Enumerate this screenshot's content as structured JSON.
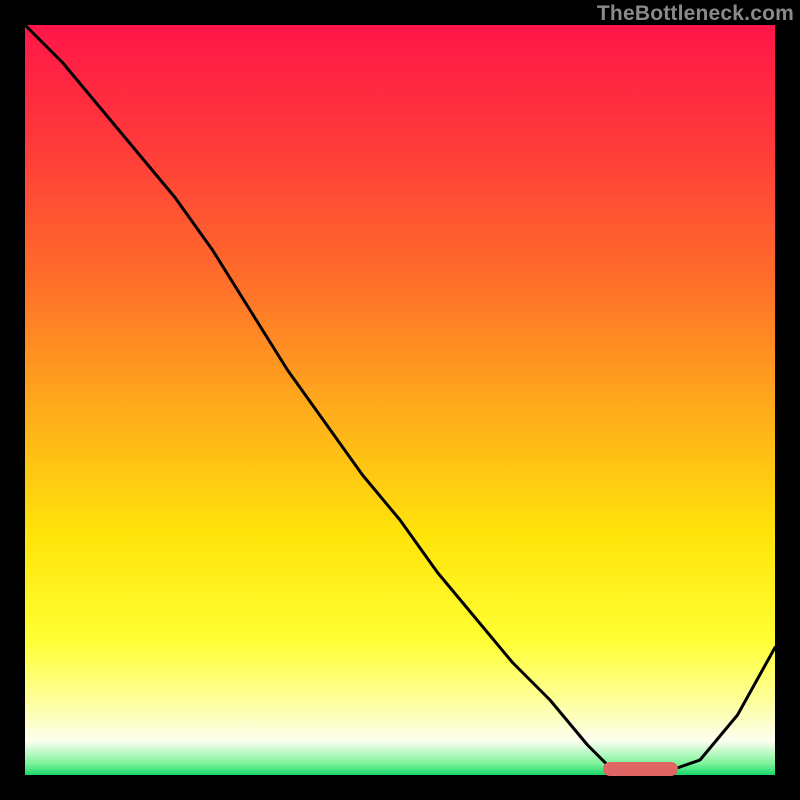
{
  "watermark": "TheBottleneck.com",
  "gradient_stops": [
    {
      "offset": 0.0,
      "color": "#ff1648"
    },
    {
      "offset": 0.16,
      "color": "#ff3a3a"
    },
    {
      "offset": 0.34,
      "color": "#ff6e2a"
    },
    {
      "offset": 0.52,
      "color": "#ffae1a"
    },
    {
      "offset": 0.68,
      "color": "#ffe40a"
    },
    {
      "offset": 0.82,
      "color": "#ffff33"
    },
    {
      "offset": 0.9,
      "color": "#ffff9a"
    },
    {
      "offset": 0.955,
      "color": "#fbfff0"
    },
    {
      "offset": 0.985,
      "color": "#7cf39a"
    },
    {
      "offset": 1.0,
      "color": "#17d76a"
    }
  ],
  "marker": {
    "x_start": 0.77,
    "x_end": 0.87,
    "y": 0.992,
    "color": "#e06666"
  },
  "chart_data": {
    "type": "line",
    "title": "",
    "xlabel": "",
    "ylabel": "",
    "xlim": [
      0,
      1
    ],
    "ylim": [
      0,
      1
    ],
    "grid": false,
    "legend": false,
    "series": [
      {
        "name": "curve",
        "color": "#000000",
        "x": [
          0.0,
          0.05,
          0.1,
          0.15,
          0.2,
          0.25,
          0.3,
          0.35,
          0.4,
          0.45,
          0.5,
          0.55,
          0.6,
          0.65,
          0.7,
          0.75,
          0.78,
          0.82,
          0.86,
          0.9,
          0.95,
          1.0
        ],
        "y": [
          1.0,
          0.95,
          0.89,
          0.83,
          0.77,
          0.7,
          0.62,
          0.54,
          0.47,
          0.4,
          0.34,
          0.27,
          0.21,
          0.15,
          0.1,
          0.04,
          0.01,
          0.005,
          0.006,
          0.02,
          0.08,
          0.17
        ]
      }
    ],
    "optimal_range": {
      "x_start": 0.77,
      "x_end": 0.87,
      "y": 0.008
    },
    "watermark": "TheBottleneck.com"
  }
}
